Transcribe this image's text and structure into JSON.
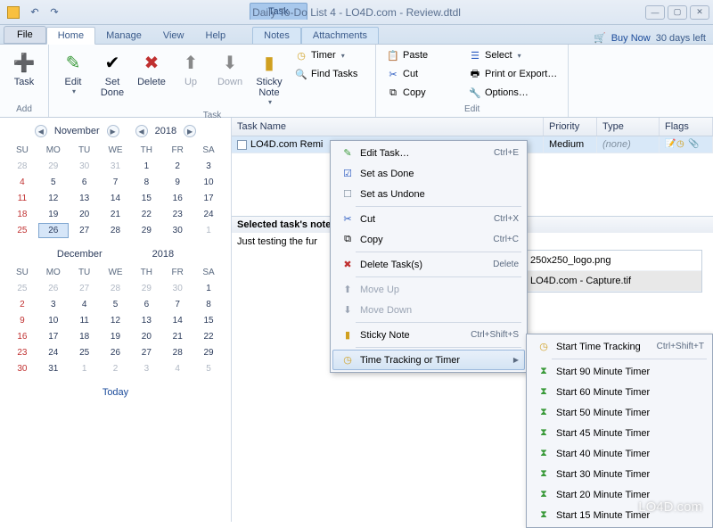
{
  "title": "Daily To-Do List 4 - LO4D.com - Review.dtdl",
  "context_tab": "Task",
  "trial": {
    "buy": "Buy Now",
    "days": "30 days left"
  },
  "tabs": {
    "file": "File",
    "home": "Home",
    "manage": "Manage",
    "view": "View",
    "help": "Help",
    "notes": "Notes",
    "attachments": "Attachments"
  },
  "ribbon": {
    "add_group": "Add",
    "task_group": "Task",
    "edit_group": "Edit",
    "task": "Task",
    "edit": "Edit",
    "set_done": "Set\nDone",
    "remove": "Delete",
    "up": "Up",
    "down": "Down",
    "sticky": "Sticky\nNote",
    "paste": "Paste",
    "cut": "Cut",
    "copy": "Copy",
    "timer": "Timer",
    "find": "Find Tasks",
    "select": "Select",
    "print": "Print or Export…",
    "options": "Options…"
  },
  "cal1": {
    "month": "November",
    "year": "2018",
    "dh": [
      "SU",
      "MO",
      "TU",
      "WE",
      "TH",
      "FR",
      "SA"
    ]
  },
  "cal2": {
    "month": "December",
    "year": "2018"
  },
  "today": "Today",
  "grid": {
    "cols": {
      "name": "Task Name",
      "priority": "Priority",
      "type": "Type",
      "flags": "Flags"
    },
    "row1": {
      "name": "LO4D.com Remi",
      "priority": "Medium",
      "type": "(none)"
    }
  },
  "notes": {
    "header": "Selected task's note",
    "body": "Just testing the fur"
  },
  "attachments": [
    "250x250_logo.png",
    "LO4D.com - Capture.tif"
  ],
  "ctx": {
    "edit": "Edit Task…",
    "edit_sc": "Ctrl+E",
    "done": "Set as Done",
    "undone": "Set as Undone",
    "cut": "Cut",
    "cut_sc": "Ctrl+X",
    "copy": "Copy",
    "copy_sc": "Ctrl+C",
    "del": "Delete Task(s)",
    "del_sc": "Delete",
    "mu": "Move Up",
    "md": "Move Down",
    "sticky": "Sticky Note",
    "sticky_sc": "Ctrl+Shift+S",
    "tt": "Time Tracking or Timer"
  },
  "sub": {
    "start": "Start Time Tracking",
    "start_sc": "Ctrl+Shift+T",
    "t90": "Start 90 Minute Timer",
    "t60": "Start 60 Minute Timer",
    "t50": "Start 50 Minute Timer",
    "t45": "Start 45 Minute Timer",
    "t40": "Start 40 Minute Timer",
    "t30": "Start 30 Minute Timer",
    "t20": "Start 20 Minute Timer",
    "t15": "Start 15 Minute Timer"
  },
  "watermark": "LO4D.com"
}
